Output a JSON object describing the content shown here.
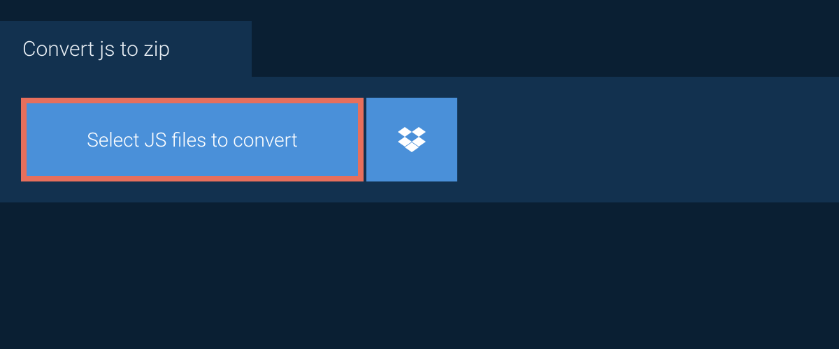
{
  "tab": {
    "label": "Convert js to zip"
  },
  "actions": {
    "select_button_label": "Select JS files to convert"
  },
  "colors": {
    "background_dark": "#0a1f33",
    "panel": "#12314f",
    "button_blue": "#4a90d9",
    "highlight_border": "#e76f5c",
    "text_light": "#e8eef4",
    "text_white": "#ffffff"
  }
}
